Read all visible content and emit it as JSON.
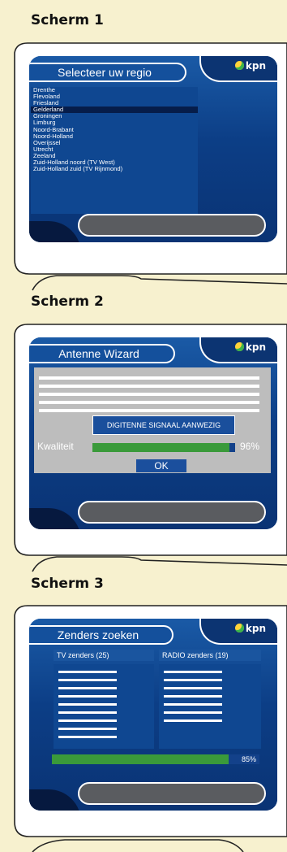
{
  "colors": {
    "page_bg": "#f7f1cf",
    "screen_blue": "#0e3f86",
    "bar_green": "#3a9a3a",
    "wizard_grey": "#bdbdbd"
  },
  "screens": [
    {
      "heading": "Scherm 1",
      "title": "Selecteer uw regio",
      "logo_text": "kpn",
      "regions": [
        "Drenthe",
        "Flevoland",
        "Friesland",
        "Gelderland",
        "Groningen",
        "Limburg",
        "Noord-Brabant",
        "Noord-Holland",
        "Overijssel",
        "Utrecht",
        "Zeeland",
        "Zuid-Holland noord (TV West)",
        "Zuid-Holland zuid (TV Rijnmond)"
      ],
      "selected_region": "Gelderland"
    },
    {
      "heading": "Scherm 2",
      "title": "Antenne Wizard",
      "logo_text": "kpn",
      "signal_status": "DIGITENNE SIGNAAL AANWEZIG",
      "quality_label": "Kwaliteit",
      "quality_value": 96,
      "quality_text": "96%",
      "ok_label": "OK"
    },
    {
      "heading": "Scherm 3",
      "title": "Zenders zoeken",
      "logo_text": "kpn",
      "tv_header": "TV zenders (25)",
      "radio_header": "RADIO zenders (19)",
      "progress_value": 85,
      "progress_text": "85%"
    }
  ]
}
